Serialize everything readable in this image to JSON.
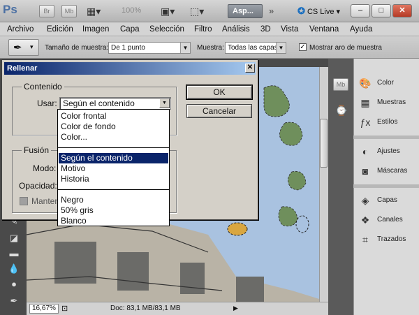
{
  "appbar": {
    "logo": "Ps",
    "bridge_icon": "Br",
    "minibridge_icon": "Mb",
    "zoom": "100%",
    "workspace_button": "Asp...",
    "cs_live": "CS Live",
    "win_minimize": "–",
    "win_maximize": "□",
    "win_close": "✕"
  },
  "menu": {
    "items": [
      "Archivo",
      "Edición",
      "Imagen",
      "Capa",
      "Selección",
      "Filtro",
      "Análisis",
      "3D",
      "Vista",
      "Ventana",
      "Ayuda"
    ]
  },
  "options": {
    "sample_size_label": "Tamaño de muestra:",
    "sample_size_value": "De 1 punto",
    "sample_label": "Muestra:",
    "sample_value": "Todas las capas",
    "show_ring_label": "Mostrar aro de muestra",
    "show_ring_checked": true
  },
  "panels": {
    "groups": [
      [
        {
          "icon": "palette-icon",
          "label": "Color"
        },
        {
          "icon": "swatches-icon",
          "label": "Muestras"
        },
        {
          "icon": "styles-icon",
          "label": "Estilos"
        }
      ],
      [
        {
          "icon": "adjustments-icon",
          "label": "Ajustes"
        },
        {
          "icon": "masks-icon",
          "label": "Máscaras"
        }
      ],
      [
        {
          "icon": "layers-icon",
          "label": "Capas"
        },
        {
          "icon": "channels-icon",
          "label": "Canales"
        },
        {
          "icon": "paths-icon",
          "label": "Trazados"
        }
      ]
    ],
    "strip_mb": "Mb"
  },
  "status": {
    "zoom": "16,67%",
    "doc_info": "Doc: 83,1 MB/83,1 MB"
  },
  "dialog": {
    "title": "Rellenar",
    "close": "✕",
    "content_group": "Contenido",
    "use_label": "Usar:",
    "use_value": "Según el contenido",
    "blend_group": "Fusión",
    "mode_label": "Modo:",
    "opacity_label": "Opacidad:",
    "preserve_label": "Manten",
    "ok": "OK",
    "cancel": "Cancelar"
  },
  "dropdown": {
    "groups": [
      [
        "Color frontal",
        "Color de fondo",
        "Color..."
      ],
      [
        "Según el contenido",
        "Motivo",
        "Historia"
      ],
      [
        "Negro",
        "50% gris",
        "Blanco"
      ]
    ],
    "selected": "Según el contenido"
  }
}
